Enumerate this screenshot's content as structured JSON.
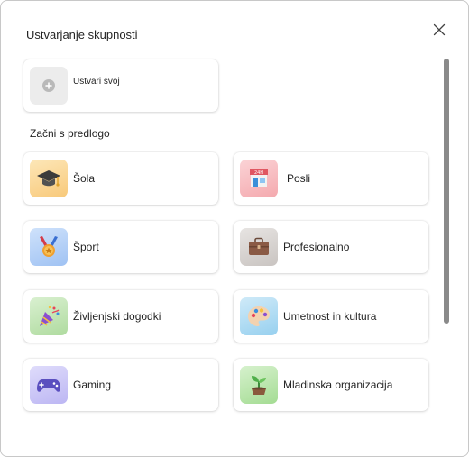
{
  "dialog": {
    "title": "Ustvarjanje skupnosti",
    "close_icon": "close-icon"
  },
  "create": {
    "label": "Ustvari svoj",
    "icon": "plus-icon"
  },
  "templates_section": {
    "label": "Začni s predlogo"
  },
  "templates": [
    {
      "label": "Šola",
      "icon": "graduation-cap-icon"
    },
    {
      "label": "Posli",
      "icon": "shop-24h-icon"
    },
    {
      "label": "Šport",
      "icon": "medal-icon"
    },
    {
      "label": "Profesionalno",
      "icon": "briefcase-icon"
    },
    {
      "label": "Življenjski dogodki",
      "icon": "party-popper-icon"
    },
    {
      "label": "Umetnost in kultura",
      "icon": "palette-icon"
    },
    {
      "label": "Gaming",
      "icon": "game-controller-icon"
    },
    {
      "label": "Mladinska organizacija",
      "icon": "sprout-icon"
    }
  ]
}
